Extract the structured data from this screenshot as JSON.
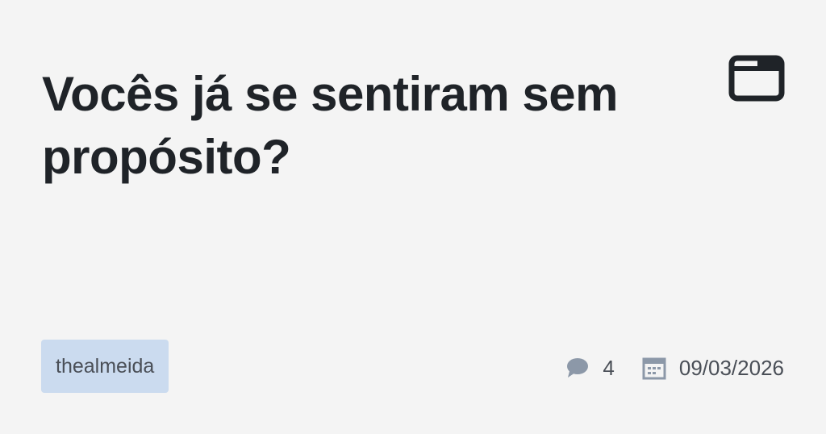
{
  "post": {
    "title": "Vocês já se sentiram sem propósito?",
    "author": "thealmeida",
    "comments_count": "4",
    "date": "09/03/2026"
  },
  "icons": {
    "window": "window-icon",
    "comment": "comment-icon",
    "calendar": "calendar-icon"
  },
  "colors": {
    "background": "#f4f4f4",
    "title": "#1f2328",
    "tag_background": "#cbdbef",
    "meta_text": "#4a4f57",
    "meta_icon": "#8c98a8"
  }
}
